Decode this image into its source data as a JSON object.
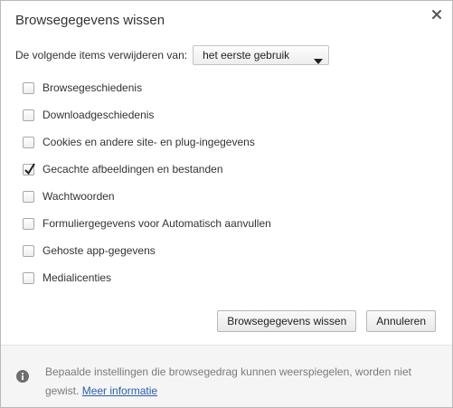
{
  "dialog": {
    "title": "Browsegegevens wissen",
    "close_icon": "close-icon"
  },
  "range": {
    "label": "De volgende items verwijderen van:",
    "selected": "het eerste gebruik"
  },
  "items": [
    {
      "label": "Browsegeschiedenis",
      "checked": false
    },
    {
      "label": "Downloadgeschiedenis",
      "checked": false
    },
    {
      "label": "Cookies en andere site- en plug-ingegevens",
      "checked": false
    },
    {
      "label": "Gecachte afbeeldingen en bestanden",
      "checked": true
    },
    {
      "label": "Wachtwoorden",
      "checked": false
    },
    {
      "label": "Formuliergegevens voor Automatisch aanvullen",
      "checked": false
    },
    {
      "label": "Gehoste app-gegevens",
      "checked": false
    },
    {
      "label": "Medialicenties",
      "checked": false
    }
  ],
  "buttons": {
    "clear_label": "Browsegegevens wissen",
    "cancel_label": "Annuleren"
  },
  "footer": {
    "info_text": "Bepaalde instellingen die browsegedrag kunnen weerspiegelen, worden niet gewist.",
    "link_text": "Meer informatie",
    "icon": "info-icon"
  },
  "colors": {
    "link": "#2a5db0",
    "footer_bg": "#f5f5f5"
  }
}
